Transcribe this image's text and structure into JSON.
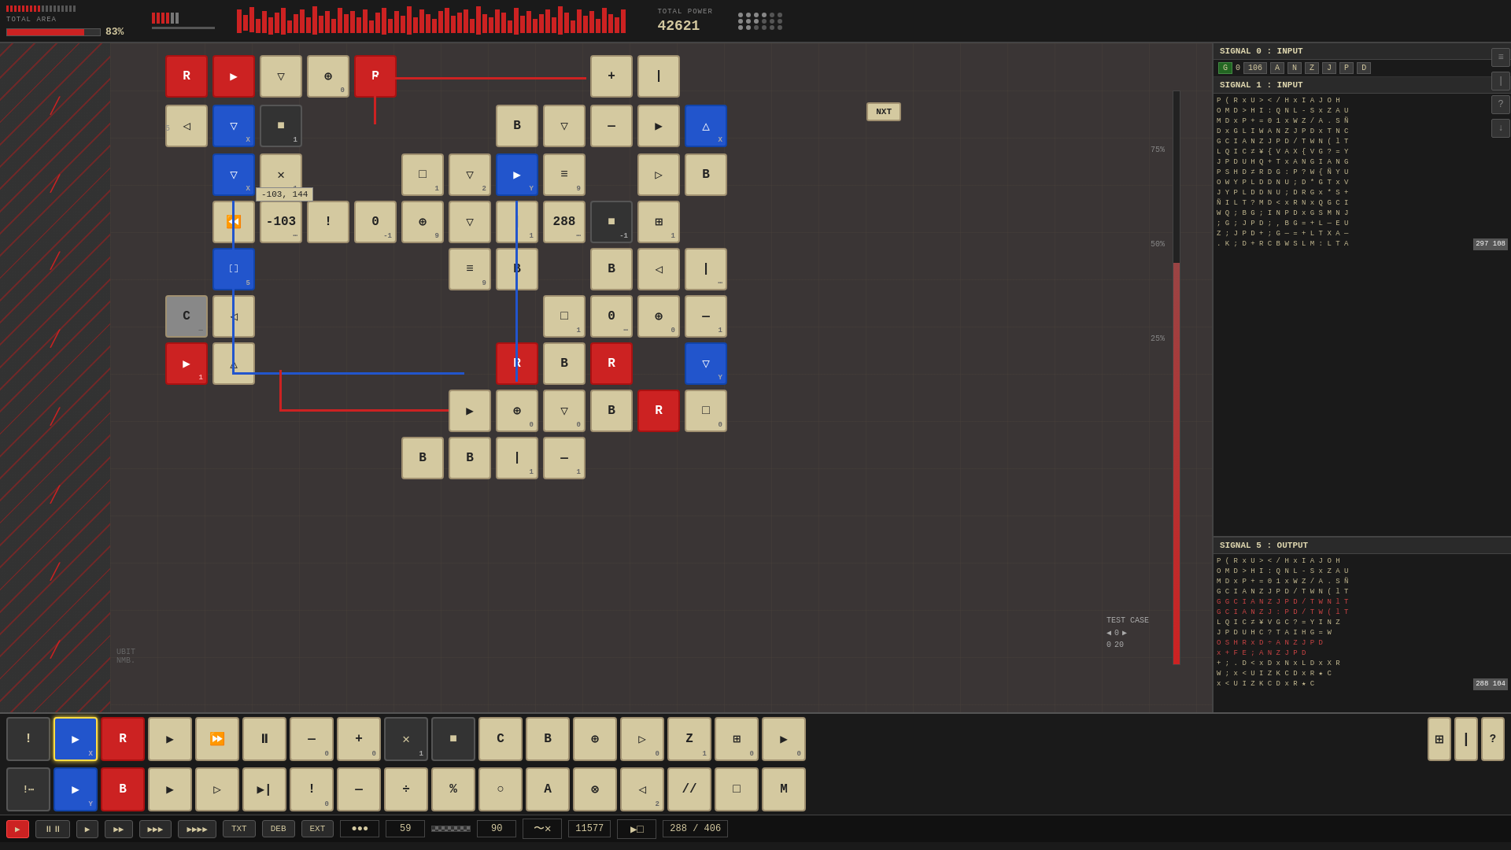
{
  "topbar": {
    "total_area_label": "TOTAL AREA",
    "area_percent": "83%",
    "total_power_label": "TOTAL POWER",
    "total_power_value": "42621",
    "nxt_label": "NXT"
  },
  "signals": {
    "signal0": {
      "header": "SIGNAL 0 : INPUT",
      "controls": [
        "G",
        "0",
        "106",
        "A",
        "N",
        "Z",
        "J",
        "P",
        "D"
      ]
    },
    "signal1": {
      "header": "SIGNAL 1 : INPUT"
    },
    "signal5": {
      "header": "SIGNAL 5 : OUTPUT"
    }
  },
  "test_case": {
    "label": "TEST CASE",
    "value1": "0",
    "value2": "20"
  },
  "circuit": {
    "tooltip": "-103, 144",
    "value_display": "-103"
  },
  "bottom_toolbar": {
    "rows": [
      {
        "cells": [
          {
            "icon": "!",
            "sub": "",
            "type": "dark"
          },
          {
            "icon": "▶",
            "sub": "X",
            "type": "blue"
          },
          {
            "icon": "R",
            "sub": "",
            "type": "red"
          },
          {
            "icon": "▶",
            "sub": "",
            "type": "gold"
          },
          {
            "icon": "▶▶",
            "sub": "",
            "type": "gold"
          },
          {
            "icon": "⏸",
            "sub": "",
            "type": "gold"
          },
          {
            "icon": "—",
            "sub": "",
            "type": "gold"
          },
          {
            "icon": "+",
            "sub": "",
            "type": "gold"
          },
          {
            "icon": "×",
            "sub": "1",
            "type": "dark"
          },
          {
            "icon": "■",
            "sub": "",
            "type": "dark"
          },
          {
            "icon": "C",
            "sub": "",
            "type": "gold"
          },
          {
            "icon": "B",
            "sub": "",
            "type": "gold"
          },
          {
            "icon": "⊕",
            "sub": "",
            "type": "gold"
          },
          {
            "icon": "▶",
            "sub": "0",
            "type": "gold"
          },
          {
            "icon": "Z",
            "sub": "1",
            "type": "gold"
          },
          {
            "icon": "⊞",
            "sub": "0",
            "type": "gold"
          },
          {
            "icon": "▶",
            "sub": "0",
            "type": "gold"
          }
        ]
      },
      {
        "cells": [
          {
            "icon": "!⋯",
            "sub": "",
            "type": "dark"
          },
          {
            "icon": "▶",
            "sub": "Y",
            "type": "blue"
          },
          {
            "icon": "B",
            "sub": "",
            "type": "red"
          },
          {
            "icon": "▶",
            "sub": "",
            "type": "gold"
          },
          {
            "icon": "▷",
            "sub": "",
            "type": "gold"
          },
          {
            "icon": "▶|",
            "sub": "",
            "type": "gold"
          },
          {
            "icon": "!",
            "sub": "0",
            "type": "gold"
          },
          {
            "icon": "—",
            "sub": "",
            "type": "gold"
          },
          {
            "icon": "÷",
            "sub": "",
            "type": "gold"
          },
          {
            "icon": "%",
            "sub": "",
            "type": "gold"
          },
          {
            "icon": "○",
            "sub": "",
            "type": "gold"
          },
          {
            "icon": "A",
            "sub": "",
            "type": "gold"
          },
          {
            "icon": "⊗",
            "sub": "",
            "type": "gold"
          },
          {
            "icon": "◁",
            "sub": "2",
            "type": "gold"
          },
          {
            "icon": "//",
            "sub": "",
            "type": "gold"
          },
          {
            "icon": "□",
            "sub": "",
            "type": "gold"
          },
          {
            "icon": "M",
            "sub": "",
            "type": "gold"
          }
        ]
      }
    ],
    "action_bar": {
      "buttons": [
        "▶",
        "⏸⏸",
        "▶",
        "▶▶",
        "▶▶▶",
        "▶▶▶▶",
        "TXT",
        "DEB",
        "EXT"
      ],
      "values": [
        "59",
        "90",
        "11577",
        "288 / 406"
      ]
    }
  },
  "percentages": [
    "75%",
    "50%",
    "25%"
  ],
  "ubit_label": "UBIT\nNMB."
}
